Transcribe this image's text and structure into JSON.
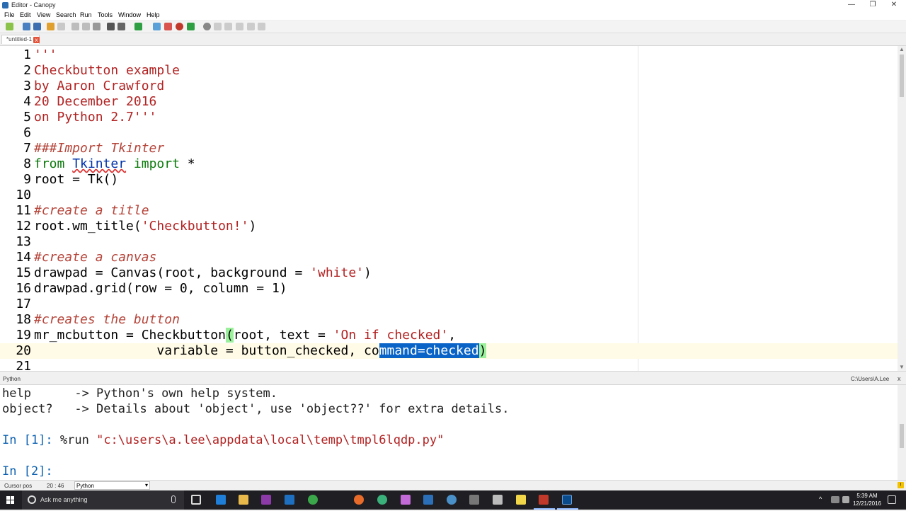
{
  "window": {
    "title": "Editor - Canopy",
    "minimize": "—",
    "maximize": "❐",
    "close": "✕"
  },
  "menu": [
    "File",
    "Edit",
    "View",
    "Search",
    "Run",
    "Tools",
    "Window",
    "Help"
  ],
  "tab": {
    "label": "*untitled-1",
    "close": "x"
  },
  "editor": {
    "line_numbers": [
      "1",
      "2",
      "3",
      "4",
      "5",
      "6",
      "7",
      "8",
      "9",
      "10",
      "11",
      "12",
      "13",
      "14",
      "15",
      "16",
      "17",
      "18",
      "19",
      "20",
      "21"
    ],
    "lines": {
      "l1": "'''",
      "l2": "Checkbutton example",
      "l3": "by Aaron Crawford",
      "l4": "20 December 2016",
      "l5": "on Python 2.7'''",
      "l7": "###Import Tkinter",
      "l8_kw1": "from",
      "l8_mod": "Tkinter",
      "l8_kw2": "import",
      "l8_rest": " *",
      "l9": "root = Tk()",
      "l11": "#create a title",
      "l12_a": "root.wm_title(",
      "l12_s": "'Checkbutton!'",
      "l12_b": ")",
      "l14": "#create a canvas",
      "l15_a": "drawpad = Canvas(root, background = ",
      "l15_s": "'white'",
      "l15_b": ")",
      "l16": "drawpad.grid(row = 0, column = 1)",
      "l18": "#creates the button",
      "l19_a": "mr_mcbutton = Checkbutton",
      "l19_br": "(",
      "l19_b": "root, text = ",
      "l19_s": "'On if checked'",
      "l19_c": ",",
      "l20_a": "                variable = button_checked, co",
      "l20_sel": "mmand=checked",
      "l20_br": ")"
    }
  },
  "shell": {
    "header_label": "Python",
    "header_path": "C:\\Users\\A.Lee",
    "close": "x",
    "line1": "help      -> Python's own help system.",
    "line2": "object?   -> Details about 'object', use 'object??' for extra details.",
    "prompt1": "In [1]:",
    "cmd1_a": " %run ",
    "cmd1_s": "\"c:\\users\\a.lee\\appdata\\local\\temp\\tmpl6lqdp.py\"",
    "prompt2": "In [2]:"
  },
  "statusbar": {
    "cursor_label": "Cursor pos",
    "cursor_value": "20 : 46",
    "language": "Python",
    "warning": "!"
  },
  "taskbar": {
    "search_placeholder": "Ask me anything",
    "time": "5:39 AM",
    "date": "12/21/2016"
  },
  "colors": {
    "selection": "#0a64c8",
    "string": "#b22222",
    "comment": "#b5453a",
    "keyword": "#0a7a0a",
    "class": "#0033aa",
    "bracket_match": "#9bf09b",
    "taskbar": "#1f1f23"
  }
}
